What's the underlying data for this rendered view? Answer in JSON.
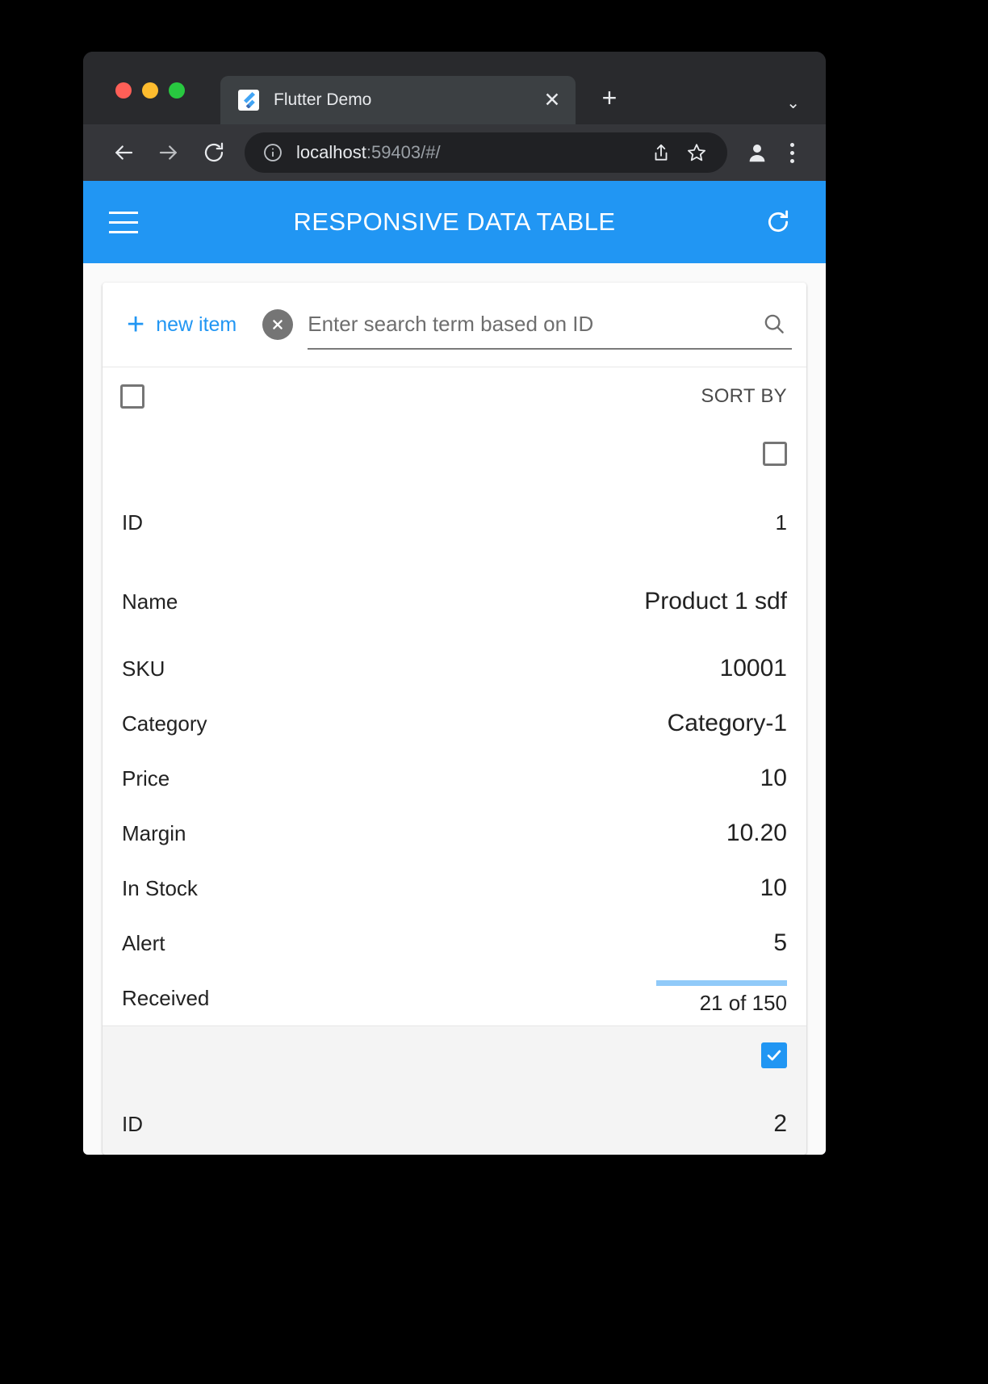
{
  "browser": {
    "tab": {
      "title": "Flutter Demo",
      "favicon_name": "flutter-logo",
      "close_label": "✕"
    },
    "new_tab_label": "+",
    "tabstrip_chevron": "⌄",
    "address_bar": {
      "host": "localhost",
      "rest": ":59403/#/",
      "info_icon": "info-icon"
    },
    "controls": {
      "back": "back-icon",
      "forward": "forward-icon",
      "reload": "reload-icon",
      "share": "share-icon",
      "bookmark": "star-icon",
      "profile": "profile-icon",
      "menu": "kebab-menu-icon"
    }
  },
  "app_bar": {
    "menu_label": "menu-icon",
    "title": "RESPONSIVE DATA TABLE",
    "refresh_label": "refresh-icon",
    "color": "#2196F3"
  },
  "toolbar": {
    "new_item_plus": "+",
    "new_item_label": "new item",
    "clear_label": "clear-icon",
    "search_placeholder": "Enter search term based on ID",
    "search_value": "",
    "search_icon_label": "search-icon"
  },
  "table_header": {
    "select_all_checked": false,
    "sort_by_label": "SORT BY"
  },
  "records": [
    {
      "selected": false,
      "alt": false,
      "fields": [
        {
          "label": "ID",
          "value": "1",
          "type": "text"
        },
        {
          "label": "Name",
          "value": "Product 1 sdf",
          "type": "text_large"
        },
        {
          "label": "SKU",
          "value": "10001",
          "type": "text"
        },
        {
          "label": "Category",
          "value": "Category-1",
          "type": "text"
        },
        {
          "label": "Price",
          "value": "10",
          "type": "text"
        },
        {
          "label": "Margin",
          "value": "10.20",
          "type": "text"
        },
        {
          "label": "In Stock",
          "value": "10",
          "type": "text"
        },
        {
          "label": "Alert",
          "value": "5",
          "type": "text"
        },
        {
          "label": "Received",
          "value": "21 of 150",
          "type": "progress",
          "current": 21,
          "total": 150,
          "percent": 14
        }
      ]
    },
    {
      "selected": true,
      "alt": true,
      "fields": [
        {
          "label": "ID",
          "value": "2",
          "type": "text"
        }
      ]
    }
  ],
  "colors": {
    "accent": "#2196F3",
    "progress_track": "#90CAF9",
    "alt_row": "#F4F4F4"
  }
}
